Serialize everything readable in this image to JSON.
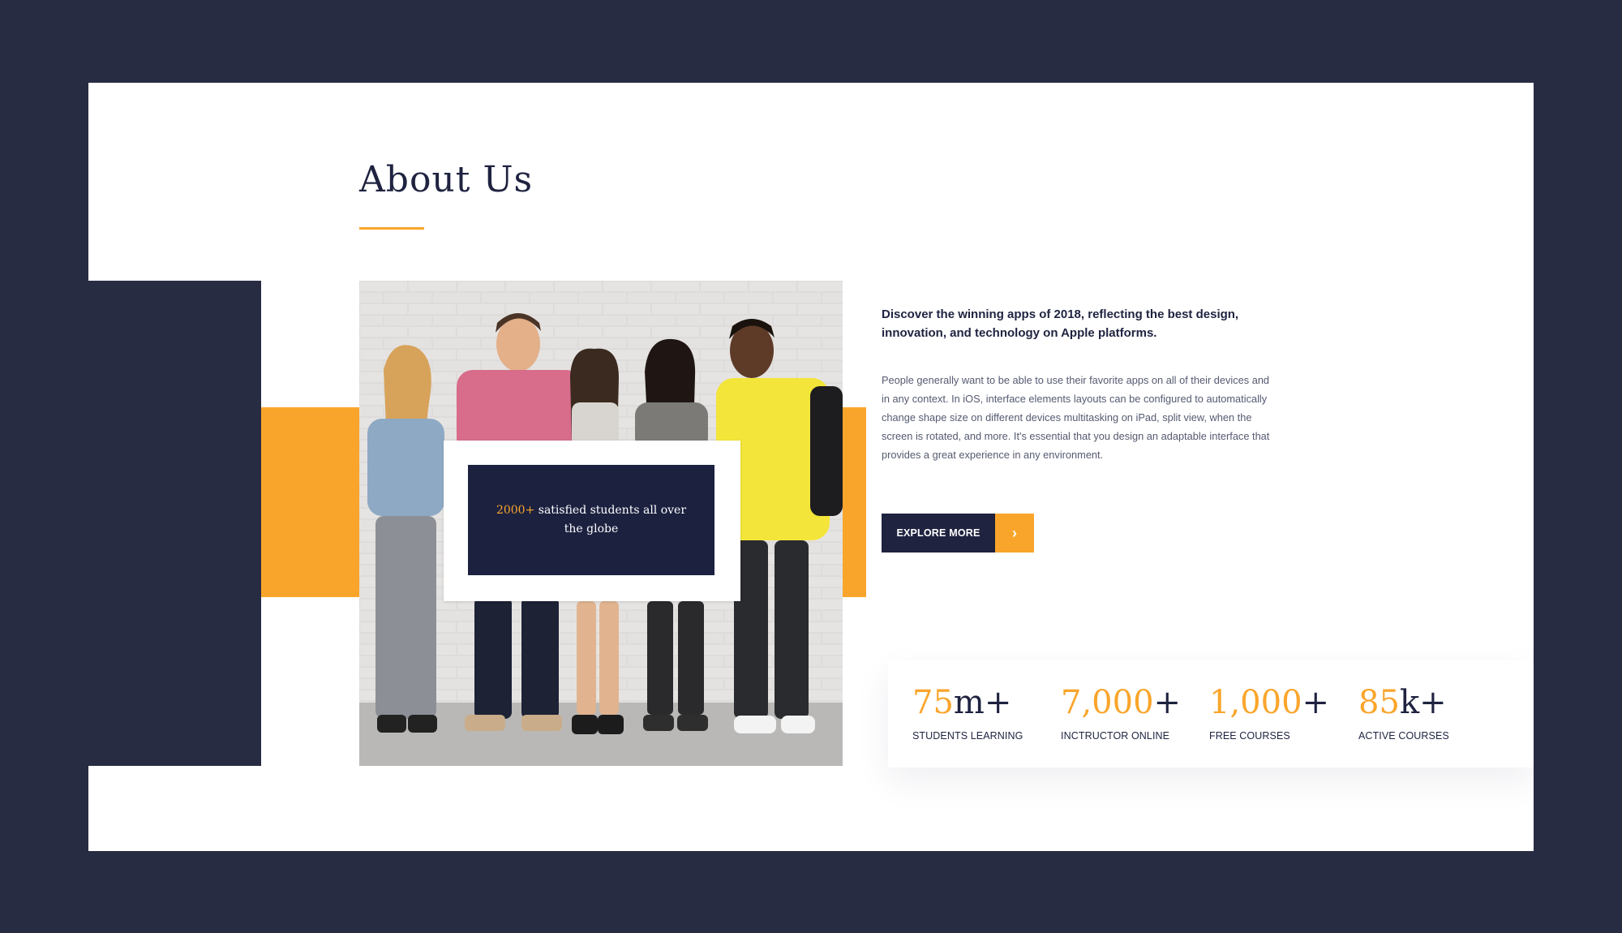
{
  "about": {
    "title": "About Us",
    "sign": {
      "number": "2000+",
      "text": " satisfied students all over the globe"
    },
    "lead": "Discover the winning apps of 2018, reflecting the best design, innovation, and technology on Apple platforms.",
    "body": "People generally want to be able to use their favorite apps on all of their devices and in any context. In iOS, interface elements layouts can be configured to automatically change shape size on different devices multitasking on iPad, split view, when the screen is rotated, and more. It's essential that you design an adaptable interface that provides a great experience in any environment.",
    "button_label": "EXPLORE MORE",
    "button_icon": "chevron-right-icon"
  },
  "stats": [
    {
      "number": "75",
      "suffix": "m+",
      "label": "STUDENTS LEARNING"
    },
    {
      "number": "7,000",
      "suffix": "+",
      "label": "INCTRUCTOR ONLINE"
    },
    {
      "number": "1,000",
      "suffix": "+",
      "label": "FREE COURSES"
    },
    {
      "number": "85",
      "suffix": "k+",
      "label": "ACTIVE COURSES"
    }
  ],
  "colors": {
    "accent": "#f9a52b",
    "navy": "#1f2340",
    "frame": "#282c43"
  }
}
